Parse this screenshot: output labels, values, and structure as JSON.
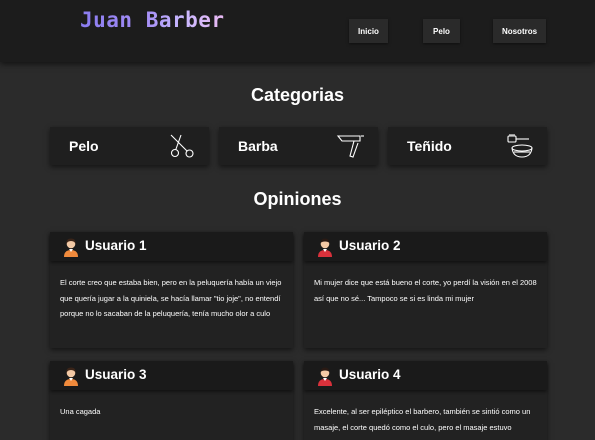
{
  "header": {
    "brand": "Juan Barber",
    "nav": [
      "Inicio",
      "Pelo",
      "Nosotros"
    ]
  },
  "categories": {
    "title": "Categorias",
    "items": [
      {
        "label": "Pelo",
        "icon": "scissors-icon"
      },
      {
        "label": "Barba",
        "icon": "razor-icon"
      },
      {
        "label": "Teñido",
        "icon": "dye-bowl-icon"
      }
    ]
  },
  "reviews": {
    "title": "Opiniones",
    "items": [
      {
        "user": "Usuario 1",
        "avatar": "female-avatar-icon",
        "text": "El corte creo que estaba bien, pero en la peluquería había un viejo que quería jugar a la quiniela, se hacía llamar \"tio joje\", no entendí porque no lo sacaban de la peluquería, tenía mucho olor a culo"
      },
      {
        "user": "Usuario 2",
        "avatar": "male-avatar-icon",
        "text": "Mi mujer dice que está bueno el corte, yo perdí la visión en el 2008 así que no sé... Tampoco se si es linda mi mujer"
      },
      {
        "user": "Usuario 3",
        "avatar": "female-avatar-icon",
        "text": "Una cagada"
      },
      {
        "user": "Usuario 4",
        "avatar": "male-avatar-icon",
        "text": "Excelente, al ser epiléptico el barbero, también se sintió como un masaje, el corte quedó como el culo, pero el masaje estuvo"
      }
    ]
  },
  "colors": {
    "background": "#2b2b2b",
    "header": "#1c1c1c",
    "card": "#1f1f1f",
    "brand_gradient": [
      "#8a7cf0",
      "#e9b8f2"
    ]
  }
}
